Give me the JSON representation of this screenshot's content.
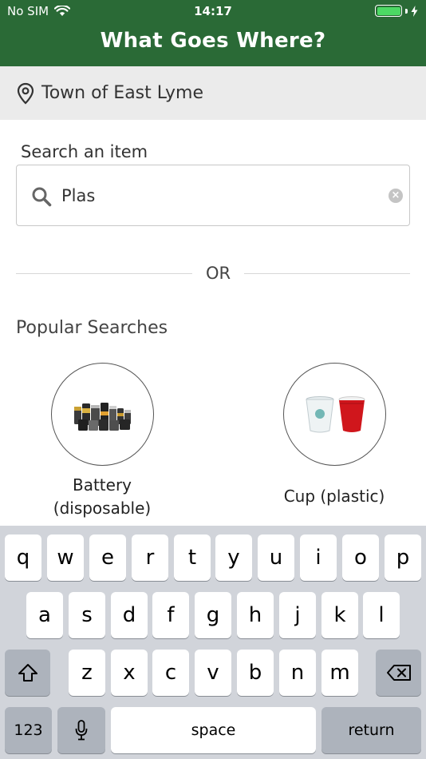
{
  "status_bar": {
    "carrier": "No SIM",
    "time": "14:17"
  },
  "header": {
    "title": "What Goes Where?"
  },
  "location": {
    "name": "Town of East Lyme"
  },
  "search": {
    "label": "Search an item",
    "value": "Plas"
  },
  "divider": {
    "or_text": "OR"
  },
  "popular": {
    "title": "Popular Searches",
    "items": [
      {
        "label": "Battery\n(disposable)"
      },
      {
        "label": "Cup (plastic)"
      }
    ]
  },
  "keyboard": {
    "row1": [
      "q",
      "w",
      "e",
      "r",
      "t",
      "y",
      "u",
      "i",
      "o",
      "p"
    ],
    "row2": [
      "a",
      "s",
      "d",
      "f",
      "g",
      "h",
      "j",
      "k",
      "l"
    ],
    "row3": [
      "z",
      "x",
      "c",
      "v",
      "b",
      "n",
      "m"
    ],
    "numbers_label": "123",
    "space_label": "space",
    "return_label": "return"
  },
  "colors": {
    "header": "#2a6a36",
    "battery": "#4cd964",
    "keyboard_bg": "#d1d4da"
  }
}
